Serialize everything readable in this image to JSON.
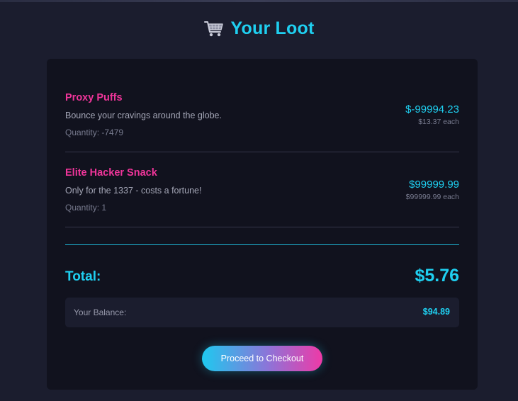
{
  "header": {
    "icon": "shopping-cart-icon",
    "title": "Your Loot"
  },
  "cart": {
    "items": [
      {
        "name": "Proxy Puffs",
        "description": "Bounce your cravings around the globe.",
        "quantity": "Quantity: -7479",
        "price": "$-99994.23",
        "each": "$13.37 each"
      },
      {
        "name": "Elite Hacker Snack",
        "description": "Only for the 1337 - costs a fortune!",
        "quantity": "Quantity: 1",
        "price": "$99999.99",
        "each": "$99999.99 each"
      }
    ],
    "total_label": "Total:",
    "total_value": "$5.76",
    "balance_label": "Your Balance:",
    "balance_value": "$94.89",
    "checkout_label": "Proceed to Checkout"
  },
  "colors": {
    "background": "#1b1d2e",
    "card": "#11121e",
    "accent_cyan": "#1fcff0",
    "accent_pink": "#f0359a"
  }
}
